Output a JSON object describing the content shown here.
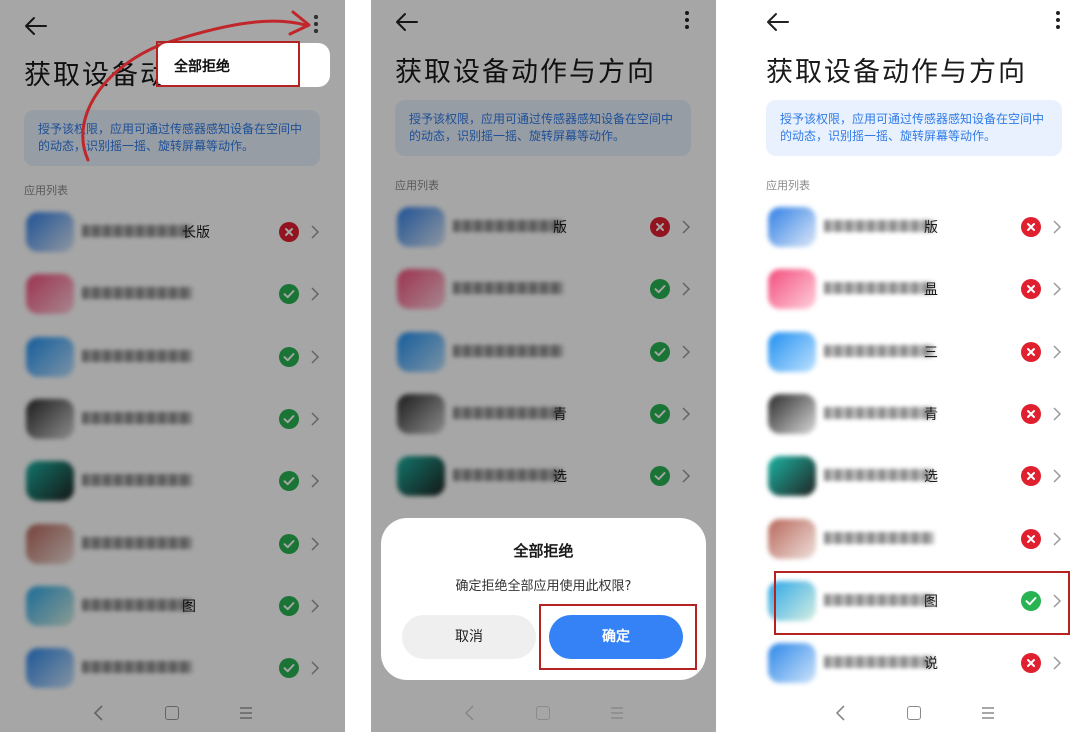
{
  "title": "获取设备动作与方向",
  "title_partial": "获取设备动",
  "info_text": "授予该权限，应用可通过传感器感知设备在空间中的动态，识别摇一摇、旋转屏幕等动作。",
  "section_label": "应用列表",
  "menu_item": "全部拒绝",
  "dialog": {
    "title": "全部拒绝",
    "message": "确定拒绝全部应用使用此权限?",
    "cancel_label": "取消",
    "confirm_label": "确定"
  },
  "apps": [
    {
      "tail": "长版",
      "color_a": "#2f7fe6",
      "color_b": "#dde8f7"
    },
    {
      "tail": "",
      "color_a": "#f24d7a",
      "color_b": "#ffd0de"
    },
    {
      "tail": "",
      "color_a": "#1f8ff0",
      "color_b": "#bfe2ff"
    },
    {
      "tail": "",
      "color_a": "#2a2a2a",
      "color_b": "#d8d8d8"
    },
    {
      "tail": "",
      "color_a": "#1bb5a4",
      "color_b": "#222222"
    },
    {
      "tail": "",
      "color_a": "#b8665a",
      "color_b": "#efe1dc"
    },
    {
      "tail": "图",
      "color_a": "#2aa7e8",
      "color_b": "#d7efe0"
    },
    {
      "tail": "",
      "color_a": "#2b86e8",
      "color_b": "#cfe4fb"
    }
  ],
  "panel2_apps": [
    {
      "tail": "版"
    },
    {
      "tail": ""
    },
    {
      "tail": ""
    },
    {
      "tail": "青"
    },
    {
      "tail": "选"
    }
  ],
  "panel3_apps": [
    {
      "tail": "版"
    },
    {
      "tail": "昷"
    },
    {
      "tail": "三"
    },
    {
      "tail": "青"
    },
    {
      "tail": "选"
    },
    {
      "tail": ""
    },
    {
      "tail": "图"
    },
    {
      "tail": "说"
    }
  ],
  "panel1_status": [
    "no",
    "ok",
    "ok",
    "ok",
    "ok",
    "ok",
    "ok",
    "ok"
  ],
  "panel2_status": [
    "no",
    "ok",
    "ok",
    "ok",
    "ok"
  ],
  "panel3_status": [
    "no",
    "no",
    "no",
    "no",
    "no",
    "no",
    "ok",
    "no"
  ],
  "colors": {
    "accent": "#3482f6",
    "ok": "#28b352",
    "deny": "#e0202f",
    "highlight": "#b42222"
  }
}
